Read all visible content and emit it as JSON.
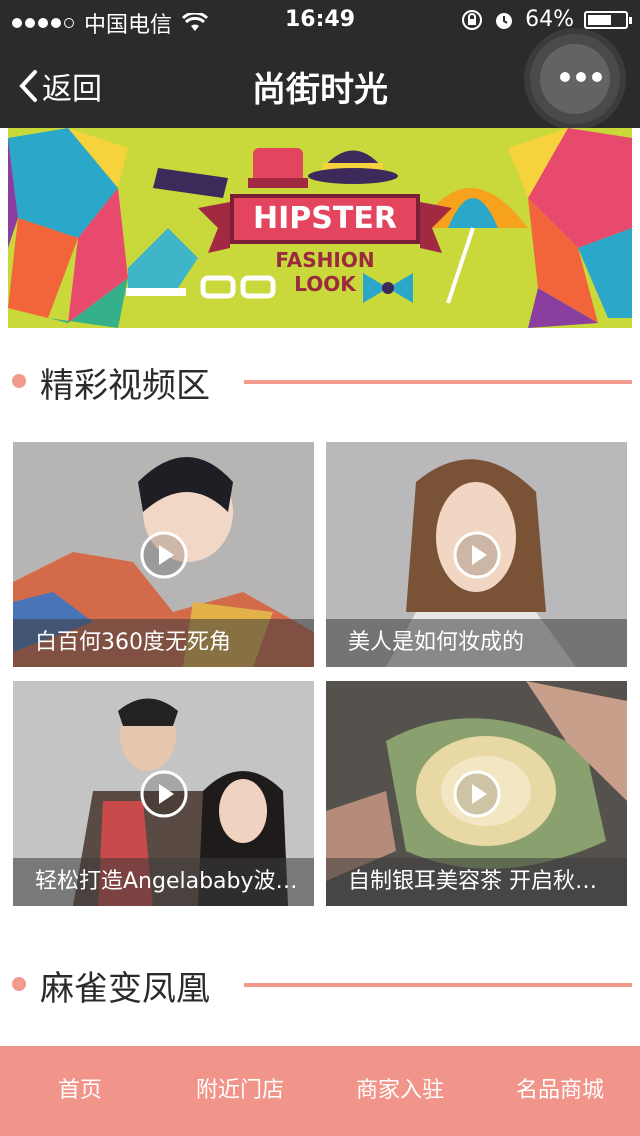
{
  "status_bar": {
    "carrier": "中国电信",
    "time": "16:49",
    "battery": "64%",
    "battery_level": 0.64
  },
  "nav": {
    "back_label": "返回",
    "title": "尚街时光"
  },
  "banner": {
    "title": "HIPSTER",
    "subtitle_line1": "FASHION",
    "subtitle_line2": "LOOK"
  },
  "sections": [
    {
      "title": "精彩视频区"
    },
    {
      "title": "麻雀变凤凰"
    }
  ],
  "videos": [
    {
      "caption": "白百何360度无死角"
    },
    {
      "caption": "美人是如何妆成的"
    },
    {
      "caption": "轻松打造Angelababy波…"
    },
    {
      "caption": "自制银耳美容茶 开启秋…"
    }
  ],
  "tabs": [
    {
      "label": "首页"
    },
    {
      "label": "附近门店"
    },
    {
      "label": "商家入驻"
    },
    {
      "label": "名品商城"
    }
  ],
  "colors": {
    "accent": "#f29a8e",
    "tab_bar": "#f1948a",
    "header": "#2b2b2b",
    "banner_bg": "#c9d83a"
  }
}
